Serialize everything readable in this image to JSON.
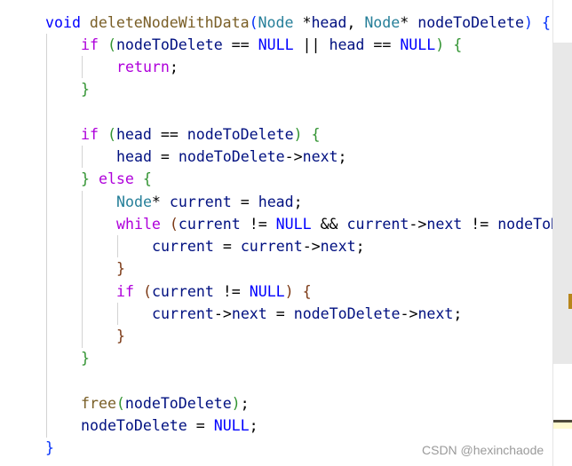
{
  "code_lines": [
    {
      "indent": 0,
      "tokens": [
        [
          "void ",
          "kw"
        ],
        [
          "deleteNodeWithData",
          "fn"
        ],
        [
          "(",
          "b1"
        ],
        [
          "Node ",
          "ty"
        ],
        [
          "*",
          "op"
        ],
        [
          "head",
          "id"
        ],
        [
          ", ",
          "op"
        ],
        [
          "Node",
          "ty"
        ],
        [
          "* ",
          "op"
        ],
        [
          "nodeToDelete",
          "id"
        ],
        [
          ")",
          "b1"
        ],
        [
          " ",
          "op"
        ],
        [
          "{",
          "b1"
        ]
      ]
    },
    {
      "indent": 1,
      "tokens": [
        [
          "if ",
          "ctl"
        ],
        [
          "(",
          "b2"
        ],
        [
          "nodeToDelete",
          "id"
        ],
        [
          " == ",
          "op"
        ],
        [
          "NULL",
          "kw"
        ],
        [
          " || ",
          "op"
        ],
        [
          "head",
          "id"
        ],
        [
          " == ",
          "op"
        ],
        [
          "NULL",
          "kw"
        ],
        [
          ")",
          "b2"
        ],
        [
          " ",
          "op"
        ],
        [
          "{",
          "b2"
        ]
      ]
    },
    {
      "indent": 2,
      "tokens": [
        [
          "return",
          "ctl"
        ],
        [
          ";",
          "op"
        ]
      ]
    },
    {
      "indent": 1,
      "tokens": [
        [
          "}",
          "b2"
        ]
      ]
    },
    {
      "indent": 0,
      "tokens": []
    },
    {
      "indent": 1,
      "tokens": [
        [
          "if ",
          "ctl"
        ],
        [
          "(",
          "b2"
        ],
        [
          "head",
          "id"
        ],
        [
          " == ",
          "op"
        ],
        [
          "nodeToDelete",
          "id"
        ],
        [
          ")",
          "b2"
        ],
        [
          " ",
          "op"
        ],
        [
          "{",
          "b2"
        ]
      ]
    },
    {
      "indent": 2,
      "tokens": [
        [
          "head",
          "id"
        ],
        [
          " = ",
          "op"
        ],
        [
          "nodeToDelete",
          "id"
        ],
        [
          "->",
          "op"
        ],
        [
          "next",
          "id"
        ],
        [
          ";",
          "op"
        ]
      ]
    },
    {
      "indent": 1,
      "tokens": [
        [
          "}",
          "b2"
        ],
        [
          " ",
          "op"
        ],
        [
          "else ",
          "ctl"
        ],
        [
          "{",
          "b2"
        ]
      ]
    },
    {
      "indent": 2,
      "tokens": [
        [
          "Node",
          "ty"
        ],
        [
          "* ",
          "op"
        ],
        [
          "current",
          "id"
        ],
        [
          " = ",
          "op"
        ],
        [
          "head",
          "id"
        ],
        [
          ";",
          "op"
        ]
      ]
    },
    {
      "indent": 2,
      "tokens": [
        [
          "while ",
          "ctl"
        ],
        [
          "(",
          "b3"
        ],
        [
          "current",
          "id"
        ],
        [
          " != ",
          "op"
        ],
        [
          "NULL",
          "kw"
        ],
        [
          " && ",
          "op"
        ],
        [
          "current",
          "id"
        ],
        [
          "->",
          "op"
        ],
        [
          "next",
          "id"
        ],
        [
          " != ",
          "op"
        ],
        [
          "nodeToDelete",
          "id"
        ]
      ]
    },
    {
      "indent": 3,
      "tokens": [
        [
          "current",
          "id"
        ],
        [
          " = ",
          "op"
        ],
        [
          "current",
          "id"
        ],
        [
          "->",
          "op"
        ],
        [
          "next",
          "id"
        ],
        [
          ";",
          "op"
        ]
      ]
    },
    {
      "indent": 2,
      "tokens": [
        [
          "}",
          "b3"
        ]
      ]
    },
    {
      "indent": 2,
      "tokens": [
        [
          "if ",
          "ctl"
        ],
        [
          "(",
          "b3"
        ],
        [
          "current",
          "id"
        ],
        [
          " != ",
          "op"
        ],
        [
          "NULL",
          "kw"
        ],
        [
          ")",
          "b3"
        ],
        [
          " ",
          "op"
        ],
        [
          "{",
          "b3"
        ]
      ]
    },
    {
      "indent": 3,
      "tokens": [
        [
          "current",
          "id"
        ],
        [
          "->",
          "op"
        ],
        [
          "next",
          "id"
        ],
        [
          " = ",
          "op"
        ],
        [
          "nodeToDelete",
          "id"
        ],
        [
          "->",
          "op"
        ],
        [
          "next",
          "id"
        ],
        [
          ";",
          "op"
        ]
      ]
    },
    {
      "indent": 2,
      "tokens": [
        [
          "}",
          "b3"
        ]
      ]
    },
    {
      "indent": 1,
      "tokens": [
        [
          "}",
          "b2"
        ]
      ]
    },
    {
      "indent": 0,
      "tokens": []
    },
    {
      "indent": 1,
      "tokens": [
        [
          "free",
          "fn"
        ],
        [
          "(",
          "b2"
        ],
        [
          "nodeToDelete",
          "id"
        ],
        [
          ")",
          "b2"
        ],
        [
          ";",
          "op"
        ]
      ]
    },
    {
      "indent": 1,
      "tokens": [
        [
          "nodeToDelete",
          "id"
        ],
        [
          " = ",
          "op"
        ],
        [
          "NULL",
          "kw"
        ],
        [
          ";",
          "op"
        ]
      ]
    },
    {
      "indent": 0,
      "tokens": [
        [
          "}",
          "b1"
        ]
      ]
    }
  ],
  "watermark": "CSDN @hexinchaode",
  "colors": {
    "keyword": "#0000ff",
    "control": "#af00db",
    "function": "#795e26",
    "type": "#267f99",
    "identifier": "#001080",
    "bracket1": "#0431fa",
    "bracket2": "#319331",
    "bracket3": "#7b3814",
    "scroll_marker": "#b8861b"
  }
}
